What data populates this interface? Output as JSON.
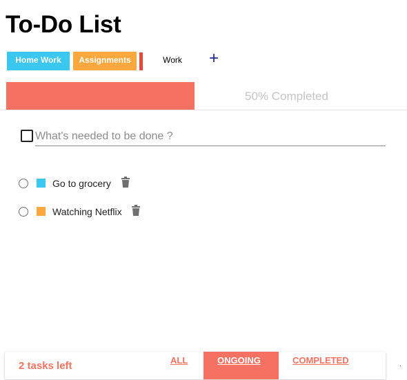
{
  "app": {
    "title": "To-Do List"
  },
  "categories": [
    {
      "label": "Home Work",
      "color": "#3bc7f0"
    },
    {
      "label": "Assignments",
      "color": "#fba93e"
    },
    {
      "label": "Work",
      "color": "#e8473b"
    }
  ],
  "add_category": {
    "icon": "plus-icon",
    "glyph": "+"
  },
  "progress": {
    "fraction": 0.5,
    "label": "50% Completed",
    "fill_color": "#f57263"
  },
  "new_task": {
    "placeholder": "What's needed to be done ?",
    "value": ""
  },
  "tasks": [
    {
      "label": "Go to grocery",
      "color": "#3bc7f0",
      "done": false
    },
    {
      "label": "Watching Netflix",
      "color": "#fba93e",
      "done": false
    }
  ],
  "footer": {
    "tasks_left": "2 tasks left",
    "filters": {
      "all": "ALL",
      "ongoing": "ONGOING",
      "completed": "COMPLETED"
    },
    "active_filter": "ongoing"
  }
}
